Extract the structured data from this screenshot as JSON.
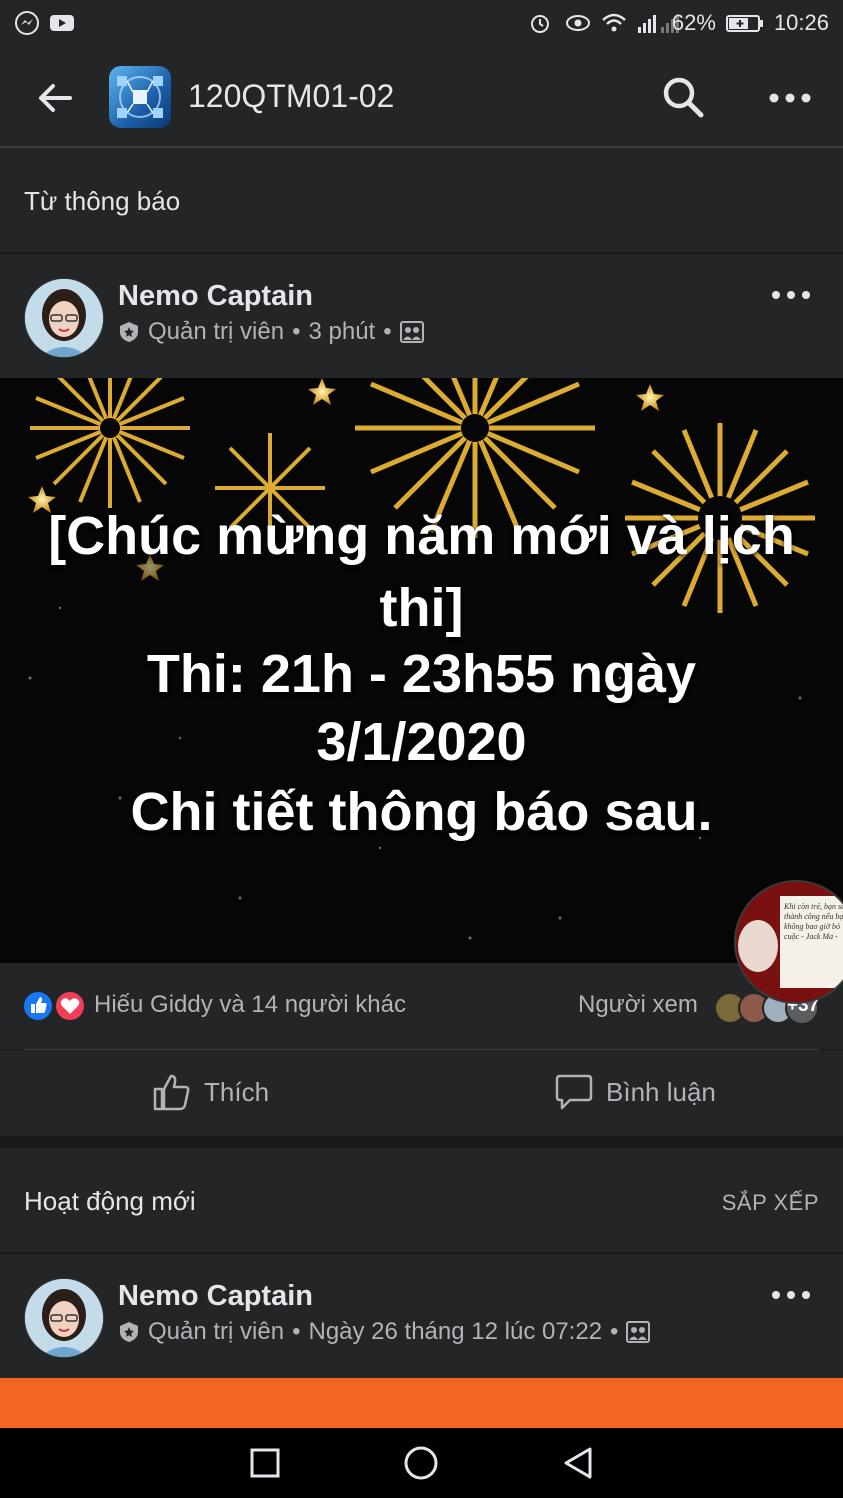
{
  "status_bar": {
    "battery": "62%",
    "time": "10:26",
    "left_icons": [
      "messenger-icon",
      "youtube-icon"
    ],
    "right_icons": [
      "alarm-icon",
      "eye-icon",
      "wifi-icon",
      "signal-icon",
      "battery-icon"
    ]
  },
  "app_bar": {
    "group_name": "120QTM01-02"
  },
  "announcements": {
    "title": "Từ thông báo"
  },
  "post1": {
    "author": "Nemo Captain",
    "role": "Quản trị viên",
    "sep": "•",
    "time": "3 phút",
    "image_lines": [
      "[Chúc mừng năm mới và lịch",
      "thi]",
      "Thi: 21h - 23h55 ngày",
      "3/1/2020",
      "Chi tiết thông báo sau."
    ],
    "reactions_text": "Hiếu Giddy và 14 người khác",
    "viewers_label": "Người xem",
    "viewers_extra": "+37",
    "like_label": "Thích",
    "comment_label": "Bình luận"
  },
  "bubble_quote": "Khi còn trẻ, bạn sẽ thành công nếu bạn không bao giờ bỏ cuộc - Jack Ma -",
  "new_activity": {
    "title": "Hoạt động mới",
    "sort_label": "SẮP XẾP"
  },
  "post2": {
    "author": "Nemo Captain",
    "role": "Quản trị viên",
    "sep": "•",
    "time": "Ngày 26 tháng 12 lúc 07:22"
  },
  "colors": {
    "background": "#18191a",
    "card": "#242526",
    "accent_orange": "#f26522",
    "like_blue": "#1877f2",
    "love_red": "#f33e58"
  }
}
